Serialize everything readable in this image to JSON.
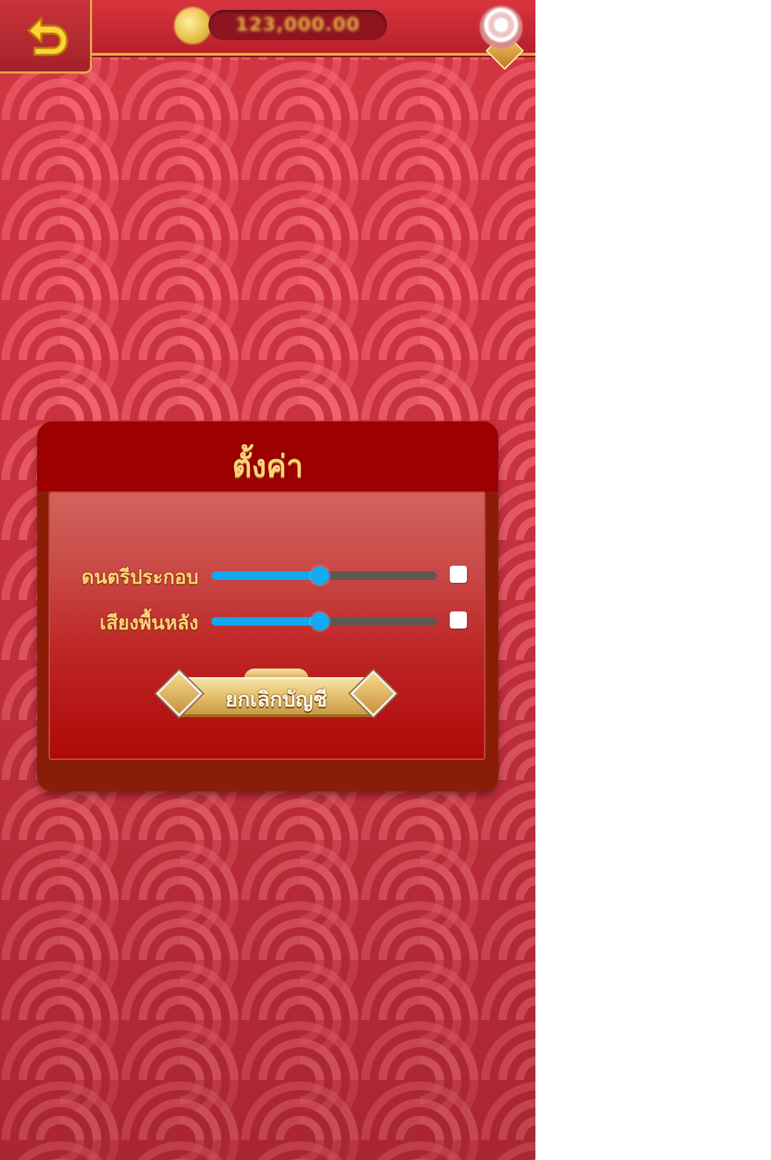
{
  "top_bar": {
    "balance": "123,000.00"
  },
  "dialog": {
    "title": "ตั้งค่า",
    "settings": [
      {
        "label": "ดนตรีประกอบ",
        "volume_percent": 48,
        "muted_checkbox_checked": false
      },
      {
        "label": "เสียงพื้นหลัง",
        "volume_percent": 48,
        "muted_checkbox_checked": false
      }
    ],
    "cancel_button_label": "ยกเลิกบัญชี"
  },
  "colors": {
    "background": "#c8323f",
    "title_text": "#ffd27a",
    "slider_active": "#11a8f0",
    "slider_inactive": "#5f5656"
  },
  "icons": {
    "back": "back-arrow-icon",
    "coin": "coin-icon",
    "avatar": "avatar-icon"
  }
}
